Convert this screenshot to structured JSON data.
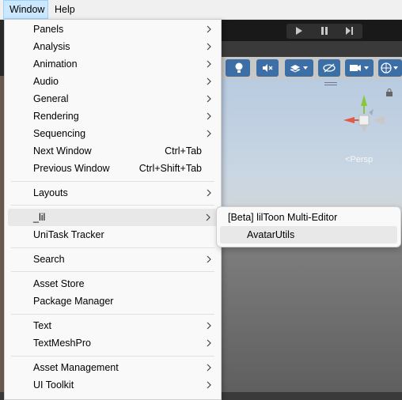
{
  "menubar": {
    "items": [
      {
        "label": "Window"
      },
      {
        "label": "Help"
      }
    ]
  },
  "menu": {
    "items": [
      {
        "label": "Panels",
        "shortcut": "",
        "submenu": true
      },
      {
        "label": "Analysis",
        "shortcut": "",
        "submenu": true
      },
      {
        "label": "Animation",
        "shortcut": "",
        "submenu": true
      },
      {
        "label": "Audio",
        "shortcut": "",
        "submenu": true
      },
      {
        "label": "General",
        "shortcut": "",
        "submenu": true
      },
      {
        "label": "Rendering",
        "shortcut": "",
        "submenu": true
      },
      {
        "label": "Sequencing",
        "shortcut": "",
        "submenu": true
      },
      {
        "label": "Next Window",
        "shortcut": "Ctrl+Tab",
        "submenu": false
      },
      {
        "label": "Previous Window",
        "shortcut": "Ctrl+Shift+Tab",
        "submenu": false
      },
      {
        "label": "Layouts",
        "shortcut": "",
        "submenu": true
      },
      {
        "label": "_lil",
        "shortcut": "",
        "submenu": true
      },
      {
        "label": "UniTask Tracker",
        "shortcut": "",
        "submenu": false
      },
      {
        "label": "Search",
        "shortcut": "",
        "submenu": true
      },
      {
        "label": "Asset Store",
        "shortcut": "",
        "submenu": false
      },
      {
        "label": "Package Manager",
        "shortcut": "",
        "submenu": false
      },
      {
        "label": "Text",
        "shortcut": "",
        "submenu": true
      },
      {
        "label": "TextMeshPro",
        "shortcut": "",
        "submenu": true
      },
      {
        "label": "Asset Management",
        "shortcut": "",
        "submenu": true
      },
      {
        "label": "UI Toolkit",
        "shortcut": "",
        "submenu": true
      }
    ]
  },
  "submenu": {
    "items": [
      {
        "label": "[Beta] lilToon Multi-Editor"
      },
      {
        "label": "AvatarUtils"
      }
    ]
  },
  "scene": {
    "persp_label": "<Persp"
  },
  "icons": {
    "submenu_arrow": "chevron-right-icon",
    "play": "play-icon",
    "pause": "pause-icon",
    "step": "step-icon"
  },
  "colors": {
    "menu_bg": "#f9f9f9",
    "highlight": "#e8e8e8",
    "menubar_active": "#cce8ff",
    "toolbar_button": "#3b6fa6"
  }
}
